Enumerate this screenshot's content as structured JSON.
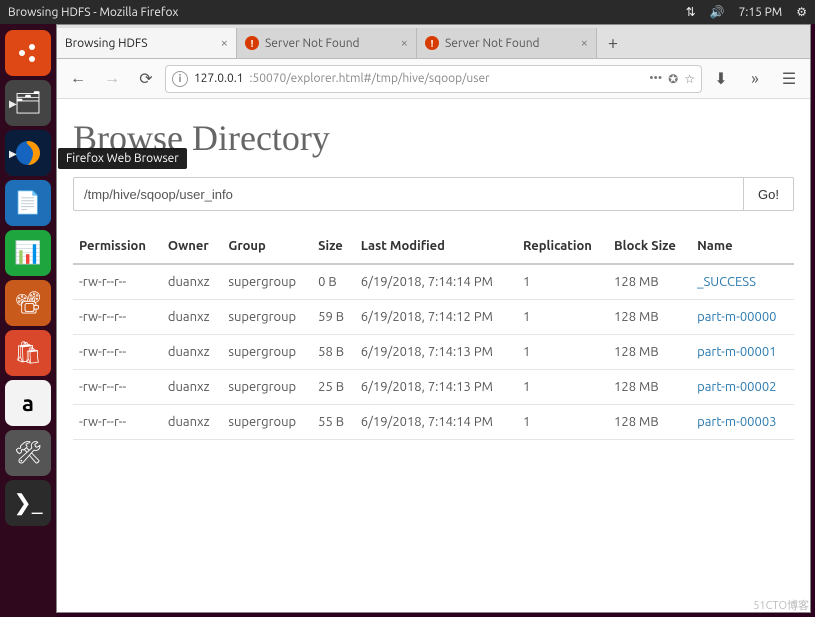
{
  "topbar": {
    "title": "Browsing HDFS - Mozilla Firefox",
    "time": "7:15 PM"
  },
  "launcher": {
    "tooltip": "Firefox Web Browser",
    "items": [
      "ubuntu",
      "files",
      "firefox",
      "writer",
      "calc",
      "impress",
      "store",
      "amazon",
      "settings",
      "terminal"
    ]
  },
  "tabs": [
    {
      "title": "Browsing HDFS",
      "warn": false,
      "active": true
    },
    {
      "title": "Server Not Found",
      "warn": true,
      "active": false
    },
    {
      "title": "Server Not Found",
      "warn": true,
      "active": false
    }
  ],
  "nav": {
    "domain": "127.0.0.1",
    "port_path": ":50070/explorer.html#/tmp/hive/sqoop/user"
  },
  "page": {
    "heading": "Browse Directory",
    "path": "/tmp/hive/sqoop/user_info",
    "go": "Go!",
    "columns": [
      "Permission",
      "Owner",
      "Group",
      "Size",
      "Last Modified",
      "Replication",
      "Block Size",
      "Name"
    ],
    "rows": [
      {
        "perm": "-rw-r--r--",
        "owner": "duanxz",
        "group": "supergroup",
        "size": "0 B",
        "lm": "6/19/2018, 7:14:14 PM",
        "rep": "1",
        "bs": "128 MB",
        "name": "_SUCCESS"
      },
      {
        "perm": "-rw-r--r--",
        "owner": "duanxz",
        "group": "supergroup",
        "size": "59 B",
        "lm": "6/19/2018, 7:14:12 PM",
        "rep": "1",
        "bs": "128 MB",
        "name": "part-m-00000"
      },
      {
        "perm": "-rw-r--r--",
        "owner": "duanxz",
        "group": "supergroup",
        "size": "58 B",
        "lm": "6/19/2018, 7:14:13 PM",
        "rep": "1",
        "bs": "128 MB",
        "name": "part-m-00001"
      },
      {
        "perm": "-rw-r--r--",
        "owner": "duanxz",
        "group": "supergroup",
        "size": "25 B",
        "lm": "6/19/2018, 7:14:13 PM",
        "rep": "1",
        "bs": "128 MB",
        "name": "part-m-00002"
      },
      {
        "perm": "-rw-r--r--",
        "owner": "duanxz",
        "group": "supergroup",
        "size": "55 B",
        "lm": "6/19/2018, 7:14:14 PM",
        "rep": "1",
        "bs": "128 MB",
        "name": "part-m-00003"
      }
    ]
  },
  "watermark": "51CTO博客"
}
